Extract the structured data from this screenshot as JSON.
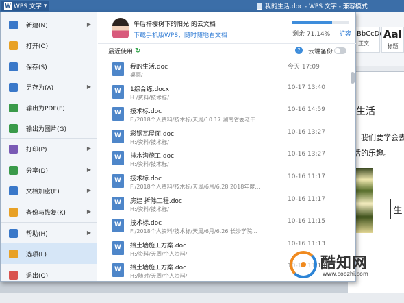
{
  "titlebar": {
    "app_label": "WPS 文字",
    "doc_title": "我的生活.doc - WPS 文字 - 兼容模式"
  },
  "ribbon": {
    "styles": [
      {
        "preview": "AaBbCcDd",
        "name": "正文"
      },
      {
        "preview": "AaI",
        "name": "标题"
      }
    ]
  },
  "document": {
    "heading_fragment": "生活",
    "line1_fragment": "。我们要学会去",
    "line2_fragment": "活的乐趣。",
    "box_text": "生"
  },
  "menu": {
    "items": [
      {
        "label": "新建(N)",
        "icon": "new-icon",
        "color": "#3a78c9",
        "arrow": true
      },
      {
        "label": "打开(O)",
        "icon": "folder-icon",
        "color": "#e8a126",
        "arrow": false
      },
      {
        "label": "保存(S)",
        "icon": "save-icon",
        "color": "#3a78c9",
        "arrow": false
      },
      {
        "label": "另存为(A)",
        "icon": "save-as-icon",
        "color": "#3a78c9",
        "arrow": true
      },
      {
        "label": "输出为PDF(F)",
        "icon": "pdf-icon",
        "color": "#3a9a4a",
        "arrow": false
      },
      {
        "label": "输出为图片(G)",
        "icon": "image-export-icon",
        "color": "#3a9a4a",
        "arrow": false
      },
      {
        "label": "打印(P)",
        "icon": "printer-icon",
        "color": "#7a5ab5",
        "arrow": true
      },
      {
        "label": "分享(D)",
        "icon": "share-icon",
        "color": "#3a9a4a",
        "arrow": true
      },
      {
        "label": "文档加密(E)",
        "icon": "lock-icon",
        "color": "#3a78c9",
        "arrow": true
      },
      {
        "label": "备份与恢复(K)",
        "icon": "backup-icon",
        "color": "#e8a126",
        "arrow": true
      },
      {
        "label": "帮助(H)",
        "icon": "help-icon",
        "color": "#3a78c9",
        "arrow": true
      },
      {
        "label": "选项(L)",
        "icon": "gear-icon",
        "color": "#e8a126",
        "arrow": false
      },
      {
        "label": "退出(Q)",
        "icon": "exit-icon",
        "color": "#d9534f",
        "arrow": false
      }
    ],
    "selected_index": 11
  },
  "cloud": {
    "name": "午后梓樱树下的阳光 的云文档",
    "promo_link": "下载手机版WPS，随时随地看文档",
    "capacity_text": "剩余 71.14%",
    "capacity_fraction": 0.71,
    "expand_label": "扩容"
  },
  "recent": {
    "title": "最近使用",
    "backup_label": "云端备份",
    "backup_on": false,
    "files": [
      {
        "name": "我的生活.doc",
        "path": "桌面/",
        "date": "今天 17:09"
      },
      {
        "name": "1综合练.docx",
        "path": "H:/资料/技术标/",
        "date": "10-17 13:40"
      },
      {
        "name": "技术标.doc",
        "path": "F:/2018个人资料/技术标/天周/10.17  湖南省委老干...",
        "date": "10-16 14:59"
      },
      {
        "name": "彩钢瓦屋面.doc",
        "path": "H:/资料/技术标/",
        "date": "10-16 13:27"
      },
      {
        "name": "排水沟施工.doc",
        "path": "H:/资料/技术标/",
        "date": "10-16 13:27"
      },
      {
        "name": "技术标.doc",
        "path": "F:/2018个人资料/技术标/天周/6月/6.28  2018年度...",
        "date": "10-16 11:17"
      },
      {
        "name": "房建 拆除工程.doc",
        "path": "H:/资料/技术标/",
        "date": "10-16 11:17"
      },
      {
        "name": "技术标.doc",
        "path": "F:/2018个人资料/技术标/天周/6月/6.26  长沙学院...",
        "date": "10-16 11:15"
      },
      {
        "name": "挡土墙施工方案.doc",
        "path": "H:/资料/天周/个人资料/",
        "date": "10-16 11:13"
      },
      {
        "name": "挡土墙施工方案.doc",
        "path": "H:/随时/天周/个人资料/",
        "date": "10-16 11:13"
      }
    ]
  },
  "watermark": {
    "title": "酷知网",
    "url": "www.coozhi.com"
  }
}
